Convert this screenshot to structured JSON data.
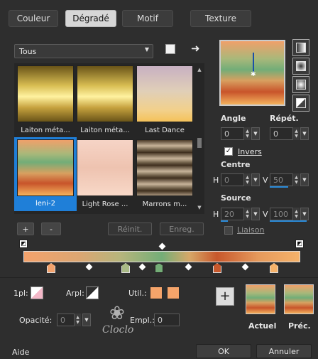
{
  "tabs": [
    {
      "label": "Couleur"
    },
    {
      "label": "Dégradé"
    },
    {
      "label": "Motif"
    },
    {
      "label": "Texture"
    }
  ],
  "active_tab": "Dégradé",
  "filter": {
    "selected": "Tous"
  },
  "gradients": [
    {
      "label": "Laiton méta..."
    },
    {
      "label": "Laiton méta..."
    },
    {
      "label": "Last Dance"
    },
    {
      "label": "leni-2",
      "selected": true
    },
    {
      "label": "Light Rose ..."
    },
    {
      "label": "Marrons m..."
    }
  ],
  "buttons": {
    "add": "+",
    "remove": "-",
    "reset": "Réinit.",
    "save": "Enreg."
  },
  "angle": {
    "label": "Angle",
    "value": "0"
  },
  "repeat": {
    "label": "Répét.",
    "value": "0"
  },
  "invert": {
    "label": "Invers",
    "checked": true
  },
  "center": {
    "label": "Centre",
    "h_label": "H",
    "h_value": "0",
    "v_label": "V",
    "v_value": "50"
  },
  "source": {
    "label": "Source",
    "h_label": "H",
    "h_value": "20",
    "v_label": "V",
    "v_value": "100"
  },
  "link": {
    "label": "Liaison"
  },
  "stops": {
    "pl_label": "1pl:",
    "arpl_label": "Arpl:",
    "util_label": "Util.:",
    "opacity_label": "Opacité:",
    "opacity_value": "0",
    "empl_label": "Empl.:",
    "empl_value": "0"
  },
  "previews": {
    "current_label": "Actuel",
    "previous_label": "Préc."
  },
  "footer": {
    "help": "Aide",
    "ok": "OK",
    "cancel": "Annuler"
  },
  "watermark": {
    "text": "Cloclo"
  },
  "colors": {
    "orange": "#f5a46a",
    "green": "#7fb37a",
    "rust": "#c85a2c",
    "accent_blue": "#1f7fd8"
  }
}
